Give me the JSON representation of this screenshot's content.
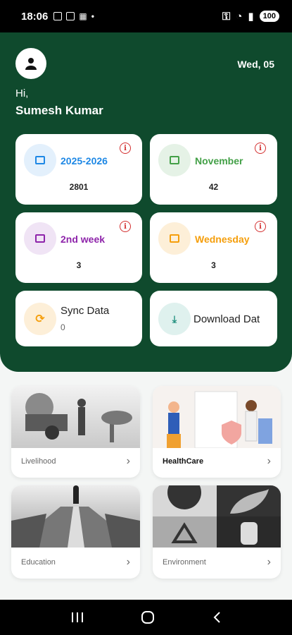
{
  "status": {
    "time": "18:06",
    "battery": "100"
  },
  "header": {
    "date": "Wed, 05",
    "greeting": "Hi,",
    "user_name": "Sumesh Kumar"
  },
  "cards": [
    {
      "title": "2025-2026",
      "value": "2801",
      "color": "#1e88e5",
      "bg": "#e3f0fc"
    },
    {
      "title": "November",
      "value": "42",
      "color": "#43a047",
      "bg": "#e5f2e6"
    },
    {
      "title": "2nd week",
      "value": "3",
      "color": "#8e24aa",
      "bg": "#f0e4f5"
    },
    {
      "title": "Wednesday",
      "value": "3",
      "color": "#f59e0b",
      "bg": "#fdefd8"
    }
  ],
  "actions": [
    {
      "title": "Sync Data",
      "value": "0"
    },
    {
      "title": "Download Dat"
    }
  ],
  "categories": [
    {
      "label": "Livelihood"
    },
    {
      "label": "HealthCare"
    },
    {
      "label": "Education"
    },
    {
      "label": "Environment"
    }
  ]
}
